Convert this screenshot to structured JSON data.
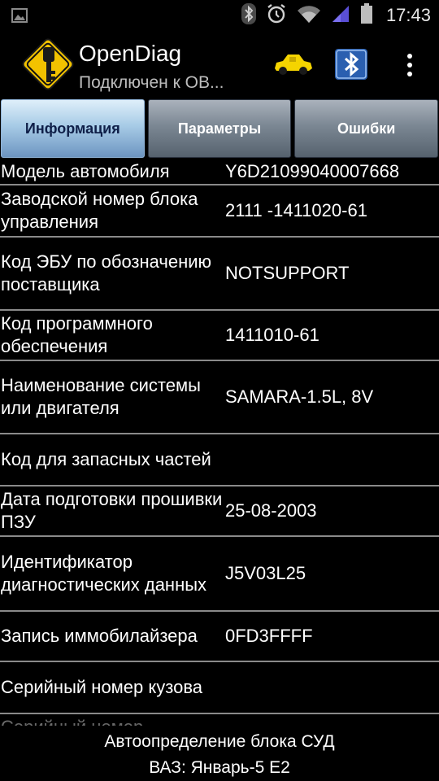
{
  "status_bar": {
    "time": "17:43",
    "icons": [
      "image-icon",
      "bluetooth-icon",
      "alarm-icon",
      "wifi-icon",
      "signal-icon",
      "battery-icon"
    ]
  },
  "app": {
    "title": "OpenDiag",
    "subtitle": "Подключен к ОВ..."
  },
  "colors": {
    "car": "#f5d400",
    "bluetooth_bg": "#2a5fb0",
    "tab_active_text": "#0f1f48",
    "divider": "#8a8a8a"
  },
  "tabs": [
    {
      "label": "Информация",
      "active": true
    },
    {
      "label": "Параметры",
      "active": false
    },
    {
      "label": "Ошибки",
      "active": false
    }
  ],
  "info_rows": [
    {
      "label": "Модель автомобиля",
      "value": "Y6D21099040007668"
    },
    {
      "label": "Заводской номер блока управления",
      "value": "2111 -1411020-61"
    },
    {
      "label": "Код ЭБУ по обозначению поставщика",
      "value": "NOTSUPPORT"
    },
    {
      "label": "Код программного обеспечения",
      "value": "1411010-61"
    },
    {
      "label": "Наименование системы или двигателя",
      "value": "SAMARA-1.5L, 8V"
    },
    {
      "label": "Код для запасных частей",
      "value": ""
    },
    {
      "label": "Дата подготовки прошивки ПЗУ",
      "value": "25-08-2003"
    },
    {
      "label": "Идентификатор диагностических данных",
      "value": "J5V03L25"
    },
    {
      "label": "Запись иммобилайзера",
      "value": "0FD3FFFF"
    },
    {
      "label": "Серийный номер кузова",
      "value": ""
    },
    {
      "label": "Серийный номер",
      "value": ""
    }
  ],
  "footer": {
    "line1": "Автоопределение блока СУД",
    "line2": "ВАЗ: Январь-5 Е2"
  }
}
